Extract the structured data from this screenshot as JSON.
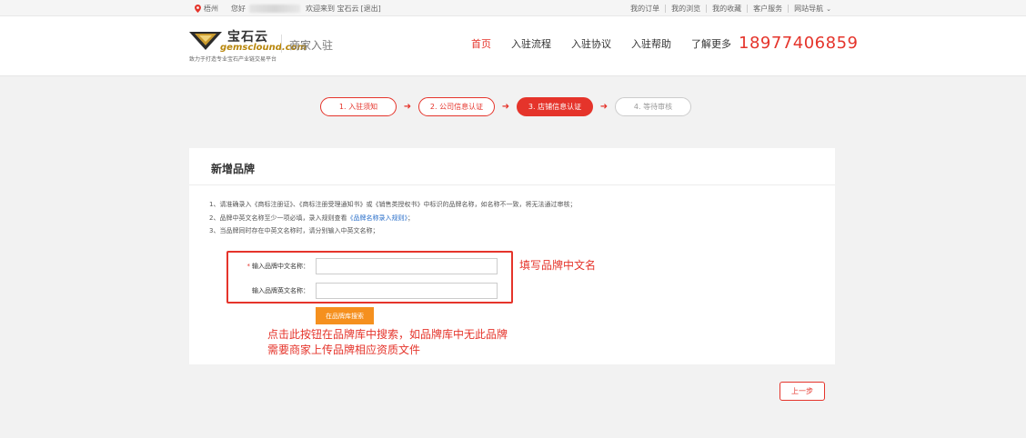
{
  "topbar": {
    "city": "梧州",
    "hello": "您好",
    "welcome_prefix": "欢迎来到 宝石云",
    "logout": "[退出]",
    "links": [
      "我的订单",
      "我的浏览",
      "我的收藏",
      "客户服务",
      "网站导航"
    ]
  },
  "header": {
    "logo_cn": "宝石云",
    "logo_en": "gemsclound.com",
    "slogan": "致力于打造专业宝石产业链交易平台",
    "merchant_label": "商家入驻",
    "nav": [
      "首页",
      "入驻流程",
      "入驻协议",
      "入驻帮助",
      "了解更多"
    ],
    "active_nav": "首页",
    "phone": "18977406859"
  },
  "steps": [
    "1. 入驻须知",
    "2. 公司信息认证",
    "3. 店铺信息认证",
    "4. 等待审核"
  ],
  "card": {
    "title": "新增品牌",
    "notes": [
      "1、请准确录入《商标注册证》、《商标注册受理通知书》或《销售类授权书》中标识的品牌名称，如名称不一致，将无法通过审核；",
      "2、品牌中英文名称至少一项必填，录入规则查看",
      "3、当品牌同时存在中英文名称时，请分别输入中英文名称；"
    ],
    "note2_link": "《品牌名称录入规则》",
    "note2_suffix": "；",
    "cn_label": "输入品牌中文名称：",
    "cn_required": "*",
    "en_label": "输入品牌英文名称：",
    "cn_value": "",
    "en_value": "",
    "search_button": "在品牌库搜索"
  },
  "annotations": {
    "fill_cn": "填写品牌中文名",
    "search_line1": "点击此按钮在品牌库中搜索，如品牌库中无此品牌",
    "search_line2": "需要商家上传品牌相应资质文件"
  },
  "prev_button": "上一步",
  "colors": {
    "accent": "#e5342b",
    "orange": "#f5901e"
  }
}
